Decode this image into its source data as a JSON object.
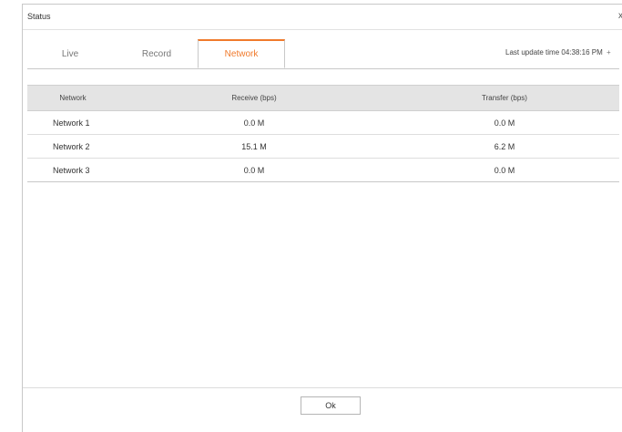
{
  "dialog": {
    "title": "Status",
    "close_label": "x"
  },
  "tabs": [
    {
      "label": "Live"
    },
    {
      "label": "Record"
    },
    {
      "label": "Network"
    }
  ],
  "active_tab": "Network",
  "last_update": {
    "label": "Last update time 04:38:16 PM",
    "refresh_icon": "+"
  },
  "table": {
    "headers": [
      "Network",
      "Receive (bps)",
      "Transfer (bps)"
    ],
    "rows": [
      {
        "name": "Network 1",
        "receive": "0.0 M",
        "transfer": "0.0 M"
      },
      {
        "name": "Network 2",
        "receive": "15.1 M",
        "transfer": "6.2 M"
      },
      {
        "name": "Network 3",
        "receive": "0.0 M",
        "transfer": "0.0 M"
      }
    ]
  },
  "footer": {
    "ok_label": "Ok"
  },
  "colors": {
    "accent": "#f07a2c",
    "header_bg": "#e4e4e4"
  }
}
